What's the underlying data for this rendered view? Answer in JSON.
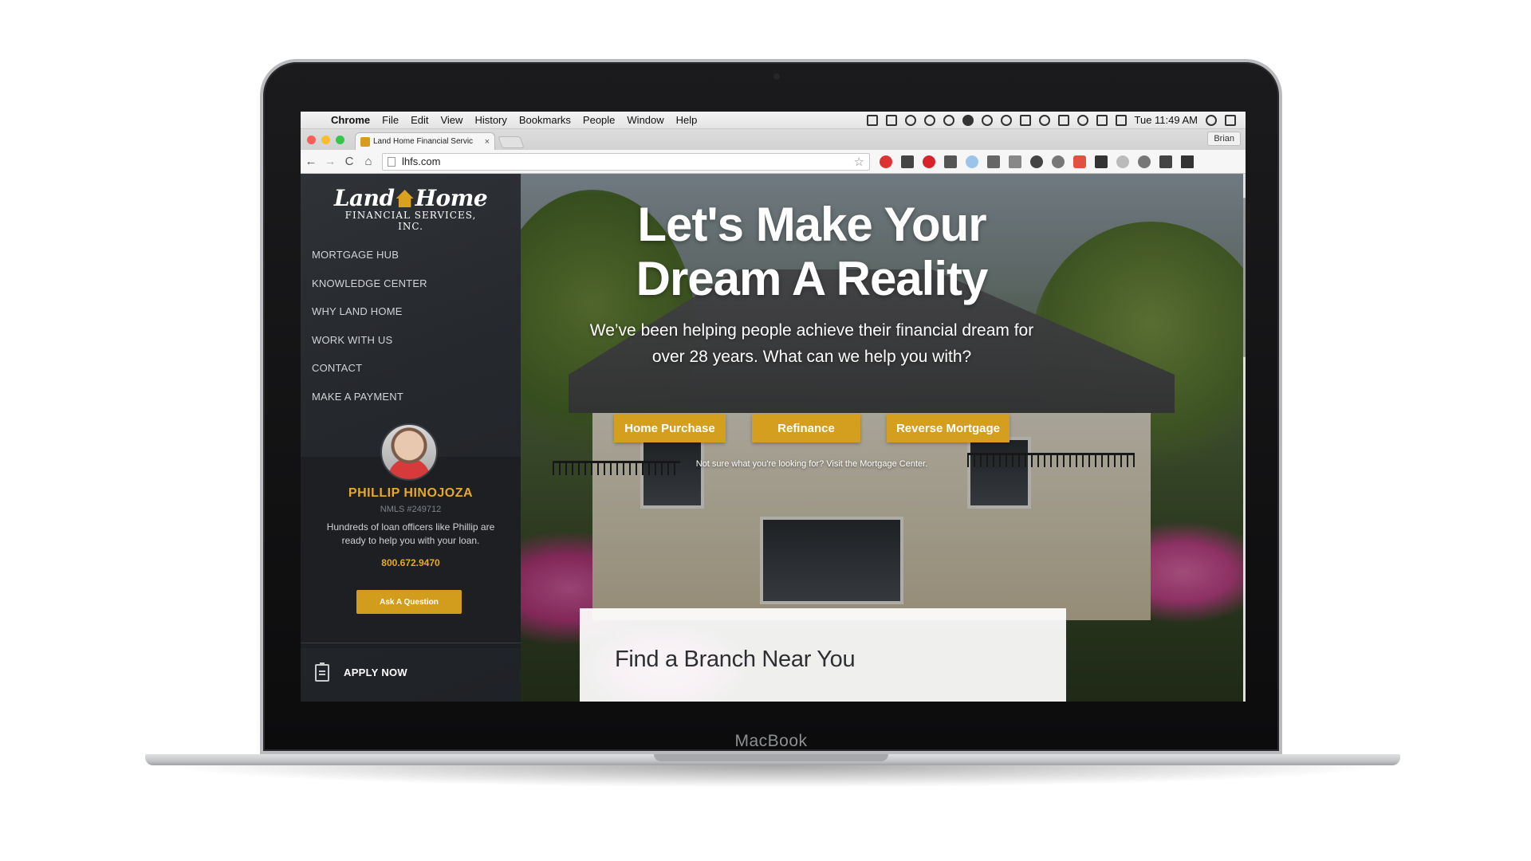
{
  "laptop": {
    "brand": "MacBook"
  },
  "menubar": {
    "apple": "",
    "items": [
      "Chrome",
      "File",
      "Edit",
      "View",
      "History",
      "Bookmarks",
      "People",
      "Window",
      "Help"
    ],
    "clock": "Tue 11:49 AM"
  },
  "browser": {
    "tab_title": "Land Home Financial Servic",
    "tab_close": "×",
    "profile": "Brian",
    "url": "lhfs.com",
    "star": "☆",
    "back": "←",
    "forward": "→",
    "reload": "C",
    "home": "⌂"
  },
  "sidebar": {
    "logo_main_left": "Land",
    "logo_main_right": "Home",
    "logo_sub": "FINANCIAL SERVICES, INC.",
    "nav": [
      "MORTGAGE HUB",
      "KNOWLEDGE CENTER",
      "WHY LAND HOME",
      "WORK WITH US",
      "CONTACT",
      "MAKE A PAYMENT"
    ],
    "loan_officer": {
      "name": "PHILLIP HINOJOZA",
      "nmls": "NMLS #249712",
      "description": "Hundreds of loan officers like Phillip are ready to help you with your loan.",
      "phone": "800.672.9470",
      "button": "Ask A Question"
    },
    "apply_label": "APPLY NOW"
  },
  "hero": {
    "title_line1": "Let's Make Your",
    "title_line2": "Dream A Reality",
    "subtitle": "We’ve been helping people achieve their financial dream for over 28 years. What can we help you with?",
    "buttons": [
      "Home Purchase",
      "Refinance",
      "Reverse Mortgage"
    ],
    "note": "Not sure what you're looking for? Visit the Mortgage Center.",
    "branch_title": "Find a Branch Near You"
  },
  "colors": {
    "accent": "#d49f1e",
    "sidebar_bg": "#25282c",
    "name_gold": "#e6a92a"
  }
}
